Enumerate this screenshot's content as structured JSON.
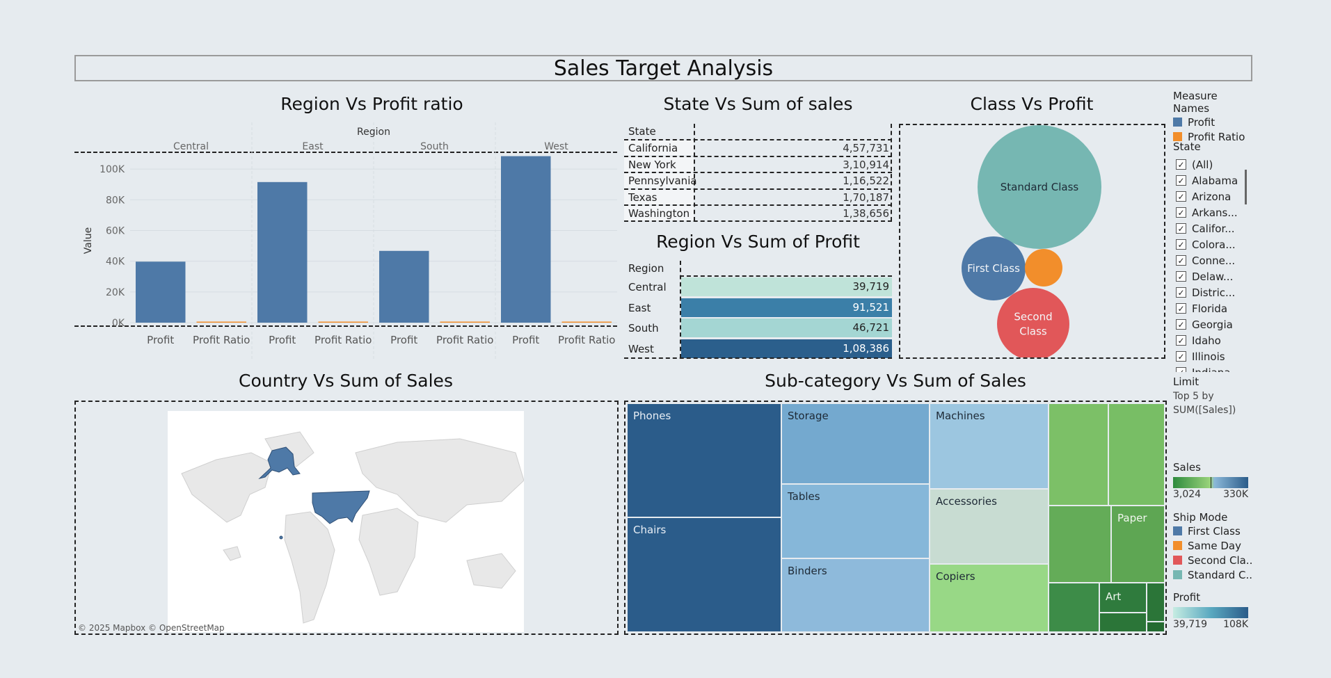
{
  "dashboard_title": "Sales Target Analysis",
  "colors": {
    "profit": "#4e79a7",
    "profit_ratio": "#f28e2b",
    "first_class": "#4e79a7",
    "same_day": "#f28e2b",
    "second_class": "#e15759",
    "standard_class": "#76b7b2"
  },
  "region_profit_chart": {
    "title": "Region Vs Profit ratio",
    "column_header": "Region",
    "y_label": "Value",
    "chart_data": {
      "type": "bar",
      "categories": [
        "Central",
        "East",
        "South",
        "West"
      ],
      "measures": [
        "Profit",
        "Profit Ratio"
      ],
      "series": [
        {
          "name": "Profit",
          "values": [
            39719,
            91521,
            46721,
            108386
          ]
        },
        {
          "name": "Profit Ratio",
          "values": [
            0.08,
            0.15,
            0.12,
            0.15
          ]
        }
      ],
      "ylim": [
        0,
        110000
      ],
      "yticks": [
        0,
        20000,
        40000,
        60000,
        80000,
        100000
      ],
      "ytick_labels": [
        "0K",
        "20K",
        "40K",
        "60K",
        "80K",
        "100K"
      ]
    }
  },
  "state_sales_table": {
    "title": "State Vs Sum of sales",
    "header": "State",
    "rows": [
      {
        "state": "California",
        "value": "4,57,731"
      },
      {
        "state": "New York",
        "value": "3,10,914"
      },
      {
        "state": "Pennsylvania",
        "value": "1,16,522"
      },
      {
        "state": "Texas",
        "value": "1,70,187"
      },
      {
        "state": "Washington",
        "value": "1,38,656"
      }
    ]
  },
  "region_sum_profit": {
    "title": "Region Vs Sum of Profit",
    "header": "Region",
    "rows": [
      {
        "region": "Central",
        "value": "39,719",
        "color": "#bfe3d9"
      },
      {
        "region": "East",
        "value": "91,521",
        "color": "#3b7fa8"
      },
      {
        "region": "South",
        "value": "46,721",
        "color": "#a4d6d3"
      },
      {
        "region": "West",
        "value": "1,08,386",
        "color": "#2b5f8c"
      }
    ]
  },
  "class_profit": {
    "title": "Class Vs Profit",
    "chart_data": {
      "type": "bubble",
      "bubbles": [
        {
          "label": "Standard Class",
          "color": "#76b7b2"
        },
        {
          "label": "First Class",
          "color": "#4e79a7"
        },
        {
          "label": "",
          "color": "#f28e2b"
        },
        {
          "label": "Second Class",
          "color": "#e15759"
        }
      ]
    }
  },
  "country_sales": {
    "title": "Country Vs Sum of Sales",
    "attribution": "© 2025 Mapbox © OpenStreetMap"
  },
  "subcategory_sales": {
    "title": "Sub-category Vs Sum of Sales",
    "cells": [
      "Phones",
      "Chairs",
      "Storage",
      "Tables",
      "Binders",
      "Machines",
      "Accessories",
      "Copiers",
      "Paper",
      "Art"
    ]
  },
  "legends": {
    "measure_names": {
      "title": "Measure Names",
      "items": [
        "Profit",
        "Profit Ratio"
      ]
    },
    "state_filter": {
      "title": "State",
      "items": [
        "(All)",
        "Alabama",
        "Arizona",
        "Arkans...",
        "Califor...",
        "Colora...",
        "Conne...",
        "Delaw...",
        "Distric...",
        "Florida",
        "Georgia",
        "Idaho",
        "Illinois",
        "Indiana"
      ]
    },
    "limit": {
      "title": "Limit",
      "text": "Top 5 by SUM([Sales])"
    },
    "sales_scale": {
      "title": "Sales",
      "min": "3,024",
      "max": "330K"
    },
    "ship_mode": {
      "title": "Ship Mode",
      "items": [
        "First Class",
        "Same Day",
        "Second Cla..",
        "Standard C.."
      ]
    },
    "profit_scale": {
      "title": "Profit",
      "min": "39,719",
      "max": "108K"
    }
  }
}
